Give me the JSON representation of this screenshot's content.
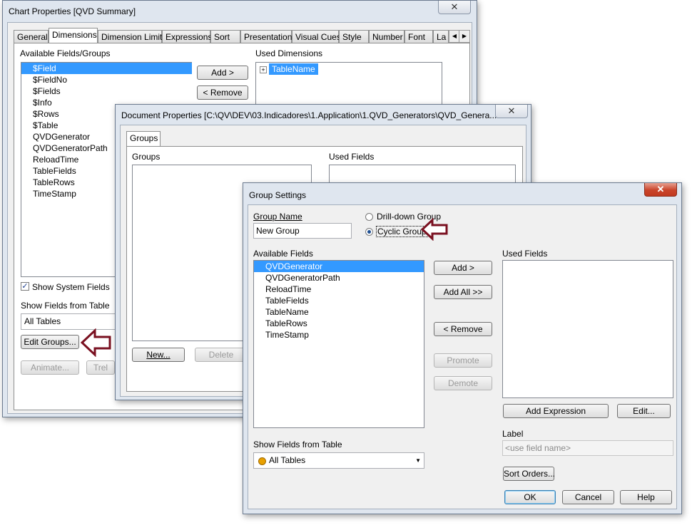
{
  "chart_props": {
    "title": "Chart Properties [QVD Summary]",
    "tabs": [
      "General",
      "Dimensions",
      "Dimension Limits",
      "Expressions",
      "Sort",
      "Presentation",
      "Visual Cues",
      "Style",
      "Number",
      "Font",
      "La"
    ],
    "available_label": "Available Fields/Groups",
    "used_label": "Used Dimensions",
    "fields": [
      "$Field",
      "$FieldNo",
      "$Fields",
      "$Info",
      "$Rows",
      "$Table",
      "QVDGenerator",
      "QVDGeneratorPath",
      "ReloadTime",
      "TableFields",
      "TableRows",
      "TimeStamp"
    ],
    "used_dims": [
      "TableName"
    ],
    "add_btn": "Add >",
    "remove_btn": "< Remove",
    "show_system": "Show System Fields",
    "show_from": "Show Fields from Table",
    "table_value": "All Tables",
    "edit_groups": "Edit Groups...",
    "animate": "Animate...",
    "trellis": "Trel"
  },
  "doc_props": {
    "title": "Document Properties [C:\\QV\\DEV\\03.Indicadores\\1.Application\\1.QVD_Generators\\QVD_Genera...",
    "tab": "Groups",
    "groups_label": "Groups",
    "used_fields_label": "Used Fields",
    "new_btn": "New...",
    "delete_btn": "Delete"
  },
  "group_settings": {
    "title": "Group Settings",
    "group_name_label": "Group Name",
    "group_name_value": "New Group",
    "drill_down": "Drill-down Group",
    "cyclic": "Cyclic Group",
    "available_label": "Available Fields",
    "fields": [
      "QVDGenerator",
      "QVDGeneratorPath",
      "ReloadTime",
      "TableFields",
      "TableName",
      "TableRows",
      "TimeStamp"
    ],
    "used_label": "Used Fields",
    "add": "Add >",
    "add_all": "Add All >>",
    "remove": "< Remove",
    "promote": "Promote",
    "demote": "Demote",
    "add_expression": "Add Expression",
    "edit": "Edit...",
    "label_label": "Label",
    "label_placeholder": "<use field name>",
    "show_from": "Show Fields from Table",
    "table_value": "All Tables",
    "sort_orders": "Sort Orders...",
    "ok": "OK",
    "cancel": "Cancel",
    "help": "Help"
  },
  "colors": {
    "arrow": "#7a1020",
    "selection": "#3399ff"
  }
}
